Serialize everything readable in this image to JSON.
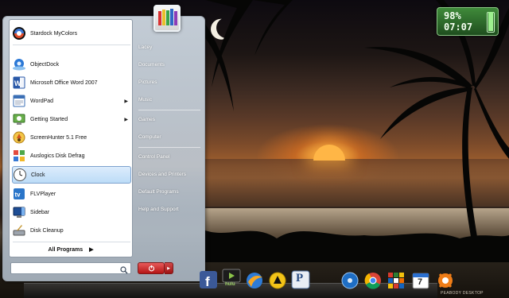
{
  "start_menu": {
    "pinned_programs": [
      {
        "label": "Stardock MyColors",
        "icon": "stardock-mycolors-icon",
        "submenu": false
      },
      {
        "label": "ObjectDock",
        "icon": "objectdock-icon",
        "submenu": false
      },
      {
        "label": "Microsoft Office Word 2007",
        "icon": "word-icon",
        "submenu": false
      },
      {
        "label": "WordPad",
        "icon": "wordpad-icon",
        "submenu": true
      },
      {
        "label": "Getting Started",
        "icon": "getting-started-icon",
        "submenu": true
      },
      {
        "label": "ScreenHunter 5.1 Free",
        "icon": "screenhunter-icon",
        "submenu": false
      },
      {
        "label": "Auslogics Disk Defrag",
        "icon": "disk-defrag-icon",
        "submenu": false
      },
      {
        "label": "Clock",
        "icon": "clock-icon",
        "submenu": false,
        "selected": true
      },
      {
        "label": "FLVPlayer",
        "icon": "flvplayer-icon",
        "submenu": false
      },
      {
        "label": "Sidebar",
        "icon": "sidebar-icon",
        "submenu": false
      },
      {
        "label": "Disk Cleanup",
        "icon": "disk-cleanup-icon",
        "submenu": false
      }
    ],
    "all_programs_label": "All Programs",
    "search": {
      "value": "",
      "placeholder": ""
    },
    "places": [
      "Lacey",
      "Documents",
      "Pictures",
      "Music",
      "Games",
      "Computer",
      "Control Panel",
      "Devices and Printers",
      "Default Programs",
      "Help and Support"
    ]
  },
  "battery_gadget": {
    "percent_text": "98%",
    "time_text": "07:07",
    "level": 0.98
  },
  "dock": {
    "items": [
      "facebook-icon",
      "hulu-icon",
      "browser-icon",
      "aim-icon",
      "pandora-icon",
      "dvd-icon",
      "chrome-icon",
      "rubiks-cube-icon",
      "calendar-icon",
      "avast-icon"
    ],
    "calendar_day": "7",
    "hulu_label": "hulu",
    "pandora_label": "P",
    "brand_label": "PEABODY DESKTOP"
  },
  "colors": {
    "selection": "#bcdcf7",
    "power_button": "#c62020",
    "battery": "#2f6e2d"
  }
}
